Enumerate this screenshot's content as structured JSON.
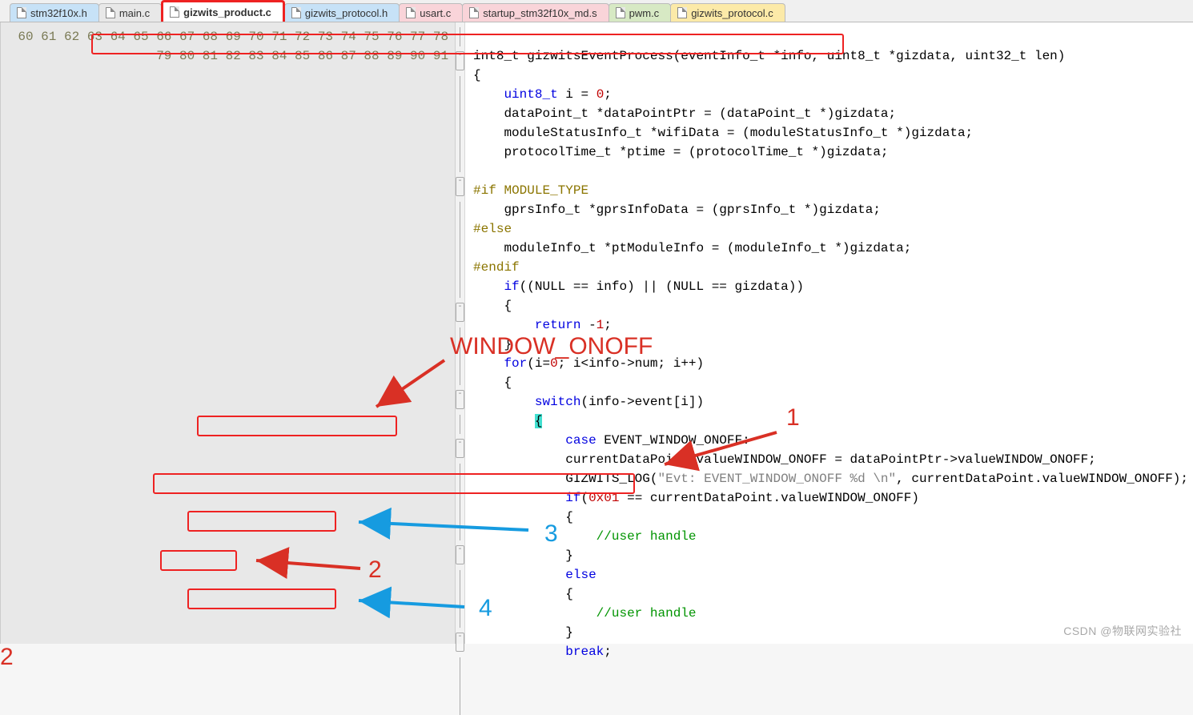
{
  "tabs": [
    {
      "label": "stm32f10x.h",
      "class": "tab-blue"
    },
    {
      "label": "main.c",
      "class": "tab-gray"
    },
    {
      "label": "gizwits_product.c",
      "class": "tab-active"
    },
    {
      "label": "gizwits_protocol.h",
      "class": "tab-blue"
    },
    {
      "label": "usart.c",
      "class": "tab-pink"
    },
    {
      "label": "startup_stm32f10x_md.s",
      "class": "tab-pink"
    },
    {
      "label": "pwm.c",
      "class": "tab-green"
    },
    {
      "label": "gizwits_protocol.c",
      "class": "tab-yellow"
    }
  ],
  "startLine": 60,
  "lineCount": 32,
  "code": {
    "l60": "int8_t gizwitsEventProcess(eventInfo_t *info, uint8_t *gizdata, uint32_t len)",
    "l61": "{",
    "l62a": "    ",
    "l62b": "uint8_t",
    "l62c": " i = ",
    "l62d": "0",
    "l62e": ";",
    "l63": "    dataPoint_t *dataPointPtr = (dataPoint_t *)gizdata;",
    "l64": "    moduleStatusInfo_t *wifiData = (moduleStatusInfo_t *)gizdata;",
    "l65": "    protocolTime_t *ptime = (protocolTime_t *)gizdata;",
    "l66": "",
    "l67a": "#if",
    "l67b": " MODULE_TYPE",
    "l68": "    gprsInfo_t *gprsInfoData = (gprsInfo_t *)gizdata;",
    "l69": "#else",
    "l70": "    moduleInfo_t *ptModuleInfo = (moduleInfo_t *)gizdata;",
    "l71": "#endif",
    "l72a": "    ",
    "l72b": "if",
    "l72c": "((NULL == info) || (NULL == gizdata))",
    "l73": "    {",
    "l74a": "        ",
    "l74b": "return",
    "l74c": " -",
    "l74d": "1",
    "l74e": ";",
    "l75": "    }",
    "l76a": "    ",
    "l76b": "for",
    "l76c": "(i=",
    "l76d": "0",
    "l76e": "; i<info->num; i++)",
    "l77": "    {",
    "l78a": "        ",
    "l78b": "switch",
    "l78c": "(info->event[i])",
    "l79a": "        ",
    "l79b": "{",
    "l80a": "            ",
    "l80b": "case",
    "l80c": " EVENT_WINDOW_ONOFF:",
    "l81": "            currentDataPoint.valueWINDOW_ONOFF = dataPointPtr->valueWINDOW_ONOFF;",
    "l82a": "            GIZWITS_LOG(",
    "l82b": "\"Evt: EVENT_WINDOW_ONOFF %d \\n\"",
    "l82c": ", currentDataPoint.valueWINDOW_ONOFF);",
    "l83a": "            ",
    "l83b": "if",
    "l83c": "(",
    "l83d": "0x01",
    "l83e": " == currentDataPoint.valueWINDOW_ONOFF)",
    "l84": "            {",
    "l85a": "                ",
    "l85b": "//user handle",
    "l86": "            }",
    "l87a": "            ",
    "l87b": "else",
    "l88": "            {",
    "l89a": "                ",
    "l89b": "//user handle",
    "l90": "            }",
    "l91a": "            ",
    "l91b": "break",
    "l91c": ";"
  },
  "annotations": {
    "label_window_onoff": "WINDOW_ONOFF",
    "label_1": "1",
    "label_2": "2",
    "label_3": "3",
    "label_4": "4"
  },
  "watermark": "CSDN @物联网实验社"
}
